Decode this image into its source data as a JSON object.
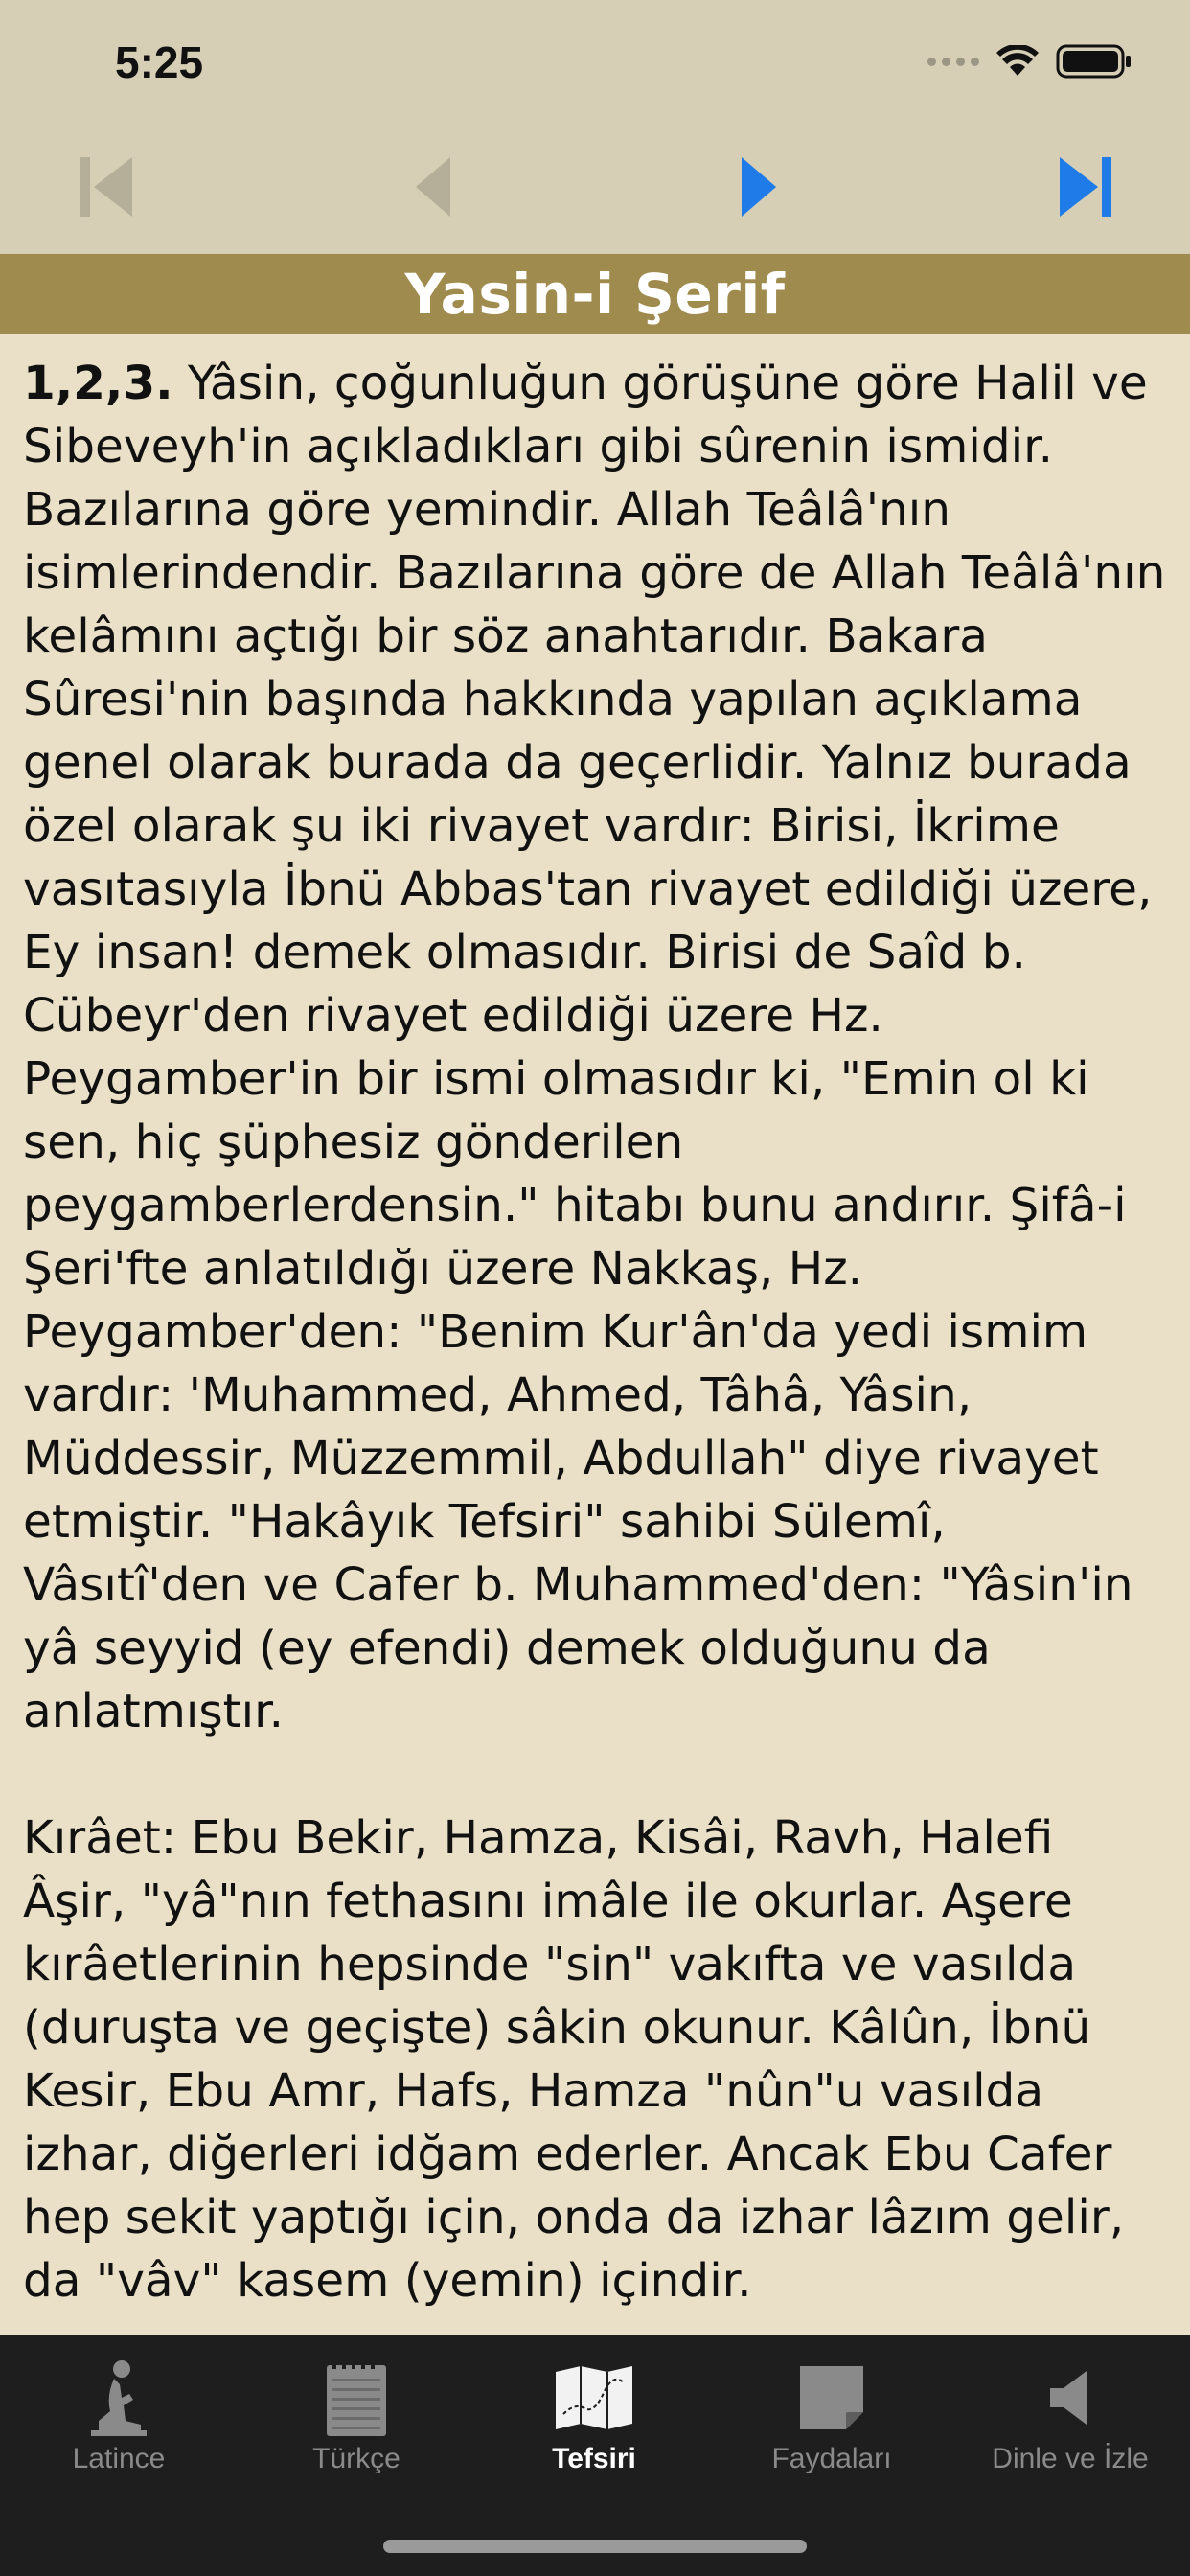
{
  "status_bar": {
    "time": "5:25",
    "signal_icon": "cellular-signal-icon",
    "wifi_icon": "wifi-icon",
    "battery_icon": "battery-icon"
  },
  "nav": {
    "first_icon": "skip-to-first-icon",
    "prev_icon": "previous-icon",
    "next_icon": "next-icon",
    "last_icon": "skip-to-last-icon",
    "colors": {
      "disabled": "#b5ae99",
      "active": "#1e7be8"
    }
  },
  "header": {
    "title": "Yasin-i Şerif",
    "color": "#a08b4f"
  },
  "content": {
    "verse_number": "1,2,3.",
    "paragraph1": " Yâsin, çoğunluğun görüşüne göre Halil ve Sibeveyh'in açıkladıkları gibi sûrenin ismidir. Bazılarına göre yemindir. Allah Teâlâ'nın isimlerindendir. Bazılarına göre de Allah Teâlâ'nın kelâmını açtığı bir söz anahtarıdır. Bakara Sûresi'nin başında hakkında yapılan açıklama genel olarak burada da geçerlidir. Yalnız burada özel olarak şu iki rivayet vardır: Birisi, İkrime vasıtasıyla İbnü Abbas'tan rivayet edildiği üzere, Ey insan! demek olmasıdır. Birisi de Saîd b. Cübeyr'den rivayet edildiği üzere Hz. Peygamber'in bir ismi olmasıdır ki, \"Emin ol ki sen, hiç şüphesiz gönderilen peygamberlerdensin.\" hitabı bunu andırır. Şifâ-i Şeri'fte anlatıldığı üzere Nakkaş, Hz. Peygamber'den: \"Benim Kur'ân'da yedi ismim vardır: 'Muhammed, Ahmed, Tâhâ, Yâsin, Müddessir, Müzzemmil, Abdullah\" diye rivayet etmiştir. \"Hakâyık Tefsiri\" sahibi Sülemî, Vâsıtî'den ve Cafer b. Muhammed'den: \"Yâsin'in yâ seyyid (ey efendi) demek olduğunu da anlatmıştır.",
    "paragraph2": "Kırâet: Ebu Bekir, Hamza, Kisâi, Ravh, Halefi Âşir, \"yâ\"nın fethasını imâle ile okurlar. Aşere kırâetlerinin hepsinde \"sin\" vakıfta ve vasılda (duruşta ve geçişte) sâkin okunur. Kâlûn, İbnü Kesir, Ebu Amr, Hafs, Hamza \"nûn\"u vasılda izhar, diğerleri idğam ederler. Ancak Ebu Cafer hep sekit yaptığı için, onda da izhar lâzım gelir, da \"vâv\" kasem (yemin) içindir."
  },
  "tabbar": {
    "tabs": [
      {
        "label": "Latince",
        "icon": "praying-person-icon",
        "active": false
      },
      {
        "label": "Türkçe",
        "icon": "notepad-icon",
        "active": false
      },
      {
        "label": "Tefsiri",
        "icon": "map-icon",
        "active": true
      },
      {
        "label": "Faydaları",
        "icon": "note-icon",
        "active": false
      },
      {
        "label": "Dinle ve İzle",
        "icon": "speaker-icon",
        "active": false
      }
    ]
  }
}
